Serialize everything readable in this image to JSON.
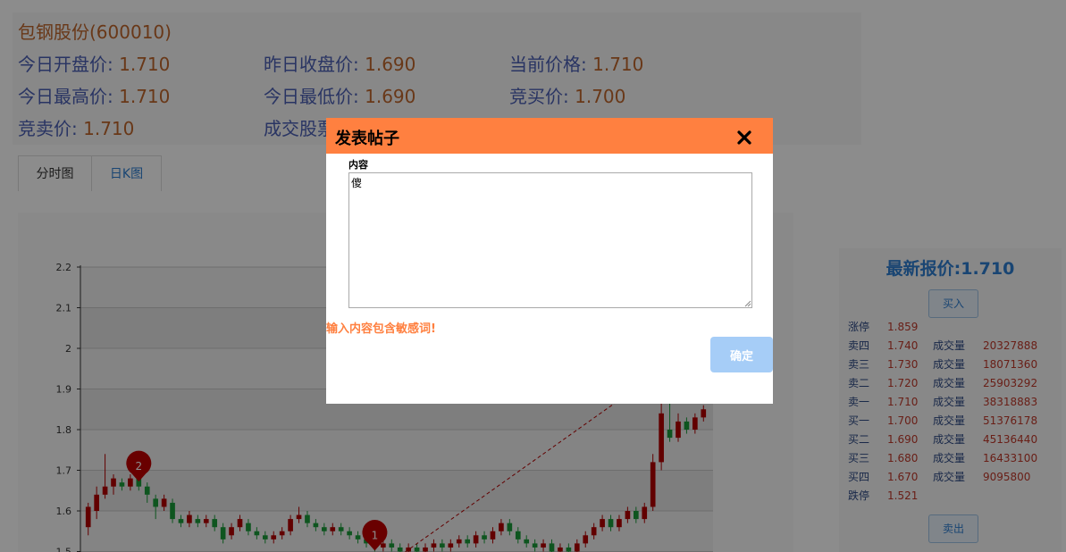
{
  "stock": {
    "name": "包钢股份(600010)",
    "row1": [
      {
        "label": "今日开盘价: ",
        "value": "1.710"
      },
      {
        "label": "昨日收盘价: ",
        "value": "1.690"
      },
      {
        "label": "当前价格: ",
        "value": "1.710"
      }
    ],
    "row2": [
      {
        "label": "今日最高价: ",
        "value": "1.710"
      },
      {
        "label": "今日最低价: ",
        "value": "1.690"
      },
      {
        "label": "竞买价: ",
        "value": "1.700"
      }
    ],
    "row3": [
      {
        "label": "竞卖价: ",
        "value": "1.710"
      },
      {
        "label": "成交股票",
        "value": ""
      }
    ]
  },
  "tabs": [
    {
      "label": "分时图"
    },
    {
      "label": "日K图"
    }
  ],
  "chart_data": {
    "type": "candlestick",
    "yticks": [
      "2.2",
      "2.1",
      "2",
      "1.9",
      "1.8",
      "1.7",
      "1.6",
      "1.5"
    ],
    "ylim": [
      1.5,
      2.2
    ],
    "grid": true,
    "markers": [
      {
        "label": "2",
        "y": 1.67
      },
      {
        "label": "1",
        "y": 1.5
      }
    ],
    "series": [
      {
        "values": [
          [
            1.56,
            1.61,
            1.54,
            1.62
          ],
          [
            1.6,
            1.64,
            1.58,
            1.66
          ],
          [
            1.64,
            1.66,
            1.63,
            1.74
          ],
          [
            1.66,
            1.68,
            1.64,
            1.69
          ],
          [
            1.67,
            1.66,
            1.65,
            1.68
          ],
          [
            1.66,
            1.68,
            1.65,
            1.69
          ],
          [
            1.68,
            1.66,
            1.65,
            1.69
          ],
          [
            1.66,
            1.64,
            1.62,
            1.67
          ],
          [
            1.63,
            1.61,
            1.58,
            1.64
          ],
          [
            1.61,
            1.63,
            1.6,
            1.64
          ],
          [
            1.62,
            1.58,
            1.57,
            1.63
          ],
          [
            1.58,
            1.57,
            1.56,
            1.59
          ],
          [
            1.57,
            1.59,
            1.56,
            1.6
          ],
          [
            1.58,
            1.57,
            1.56,
            1.59
          ],
          [
            1.57,
            1.58,
            1.56,
            1.59
          ],
          [
            1.58,
            1.56,
            1.55,
            1.59
          ],
          [
            1.56,
            1.53,
            1.52,
            1.57
          ],
          [
            1.54,
            1.56,
            1.53,
            1.57
          ],
          [
            1.56,
            1.58,
            1.55,
            1.59
          ],
          [
            1.57,
            1.55,
            1.54,
            1.58
          ],
          [
            1.55,
            1.54,
            1.53,
            1.56
          ],
          [
            1.54,
            1.53,
            1.52,
            1.55
          ],
          [
            1.53,
            1.54,
            1.52,
            1.55
          ],
          [
            1.54,
            1.55,
            1.53,
            1.56
          ],
          [
            1.55,
            1.58,
            1.54,
            1.59
          ],
          [
            1.58,
            1.59,
            1.57,
            1.61
          ],
          [
            1.59,
            1.57,
            1.56,
            1.6
          ],
          [
            1.57,
            1.56,
            1.55,
            1.58
          ],
          [
            1.56,
            1.55,
            1.54,
            1.57
          ],
          [
            1.55,
            1.56,
            1.54,
            1.57
          ],
          [
            1.56,
            1.55,
            1.54,
            1.57
          ],
          [
            1.55,
            1.54,
            1.53,
            1.56
          ],
          [
            1.54,
            1.53,
            1.52,
            1.55
          ],
          [
            1.53,
            1.52,
            1.51,
            1.54
          ],
          [
            1.52,
            1.51,
            1.5,
            1.53
          ],
          [
            1.51,
            1.52,
            1.5,
            1.53
          ],
          [
            1.52,
            1.51,
            1.5,
            1.53
          ],
          [
            1.51,
            1.5,
            1.49,
            1.52
          ],
          [
            1.5,
            1.51,
            1.49,
            1.52
          ],
          [
            1.51,
            1.5,
            1.49,
            1.52
          ],
          [
            1.5,
            1.51,
            1.49,
            1.52
          ],
          [
            1.51,
            1.52,
            1.5,
            1.53
          ],
          [
            1.52,
            1.51,
            1.5,
            1.53
          ],
          [
            1.51,
            1.52,
            1.5,
            1.53
          ],
          [
            1.52,
            1.53,
            1.51,
            1.54
          ],
          [
            1.53,
            1.52,
            1.51,
            1.54
          ],
          [
            1.52,
            1.54,
            1.51,
            1.55
          ],
          [
            1.54,
            1.53,
            1.52,
            1.55
          ],
          [
            1.53,
            1.55,
            1.52,
            1.56
          ],
          [
            1.55,
            1.57,
            1.54,
            1.58
          ],
          [
            1.57,
            1.55,
            1.54,
            1.58
          ],
          [
            1.55,
            1.53,
            1.52,
            1.56
          ],
          [
            1.53,
            1.52,
            1.51,
            1.54
          ],
          [
            1.52,
            1.51,
            1.5,
            1.53
          ],
          [
            1.51,
            1.52,
            1.5,
            1.53
          ],
          [
            1.52,
            1.5,
            1.49,
            1.53
          ],
          [
            1.5,
            1.51,
            1.49,
            1.52
          ],
          [
            1.51,
            1.5,
            1.49,
            1.52
          ],
          [
            1.5,
            1.52,
            1.49,
            1.53
          ],
          [
            1.52,
            1.54,
            1.51,
            1.55
          ],
          [
            1.54,
            1.56,
            1.53,
            1.57
          ],
          [
            1.56,
            1.58,
            1.55,
            1.59
          ],
          [
            1.58,
            1.56,
            1.55,
            1.59
          ],
          [
            1.56,
            1.58,
            1.55,
            1.59
          ],
          [
            1.58,
            1.6,
            1.57,
            1.61
          ],
          [
            1.6,
            1.58,
            1.57,
            1.61
          ],
          [
            1.58,
            1.61,
            1.57,
            1.62
          ],
          [
            1.61,
            1.72,
            1.6,
            1.74
          ],
          [
            1.72,
            1.84,
            1.7,
            1.87
          ],
          [
            1.8,
            1.78,
            1.77,
            1.87
          ],
          [
            1.78,
            1.82,
            1.77,
            1.84
          ],
          [
            1.82,
            1.8,
            1.79,
            1.83
          ],
          [
            1.8,
            1.83,
            1.79,
            1.84
          ],
          [
            1.83,
            1.85,
            1.82,
            1.86
          ]
        ]
      }
    ]
  },
  "quote": {
    "title": "最新报价:1.710",
    "buy_label": "买入",
    "sell_label": "卖出",
    "rows": [
      {
        "name": "涨停",
        "price": "1.859",
        "vol_label": "",
        "volume": ""
      },
      {
        "name": "卖四",
        "price": "1.740",
        "vol_label": "成交量",
        "volume": "20327888"
      },
      {
        "name": "卖三",
        "price": "1.730",
        "vol_label": "成交量",
        "volume": "18071360"
      },
      {
        "name": "卖二",
        "price": "1.720",
        "vol_label": "成交量",
        "volume": "25903292"
      },
      {
        "name": "卖一",
        "price": "1.710",
        "vol_label": "成交量",
        "volume": "38318883"
      },
      {
        "name": "买一",
        "price": "1.700",
        "vol_label": "成交量",
        "volume": "51376178"
      },
      {
        "name": "买二",
        "price": "1.690",
        "vol_label": "成交量",
        "volume": "45136440"
      },
      {
        "name": "买三",
        "price": "1.680",
        "vol_label": "成交量",
        "volume": "16433100"
      },
      {
        "name": "买四",
        "price": "1.670",
        "vol_label": "成交量",
        "volume": "9095800"
      },
      {
        "name": "跌停",
        "price": "1.521",
        "vol_label": "",
        "volume": ""
      }
    ]
  },
  "modal": {
    "title": "发表帖子",
    "content_label": "内容",
    "content_value": "傻",
    "error": "输入内容包含敏感词!",
    "confirm_label": "确定"
  },
  "colors": {
    "accent": "#ff8040",
    "up": "#b30000",
    "down": "#1a9c3a",
    "link": "#2f7fd1"
  }
}
